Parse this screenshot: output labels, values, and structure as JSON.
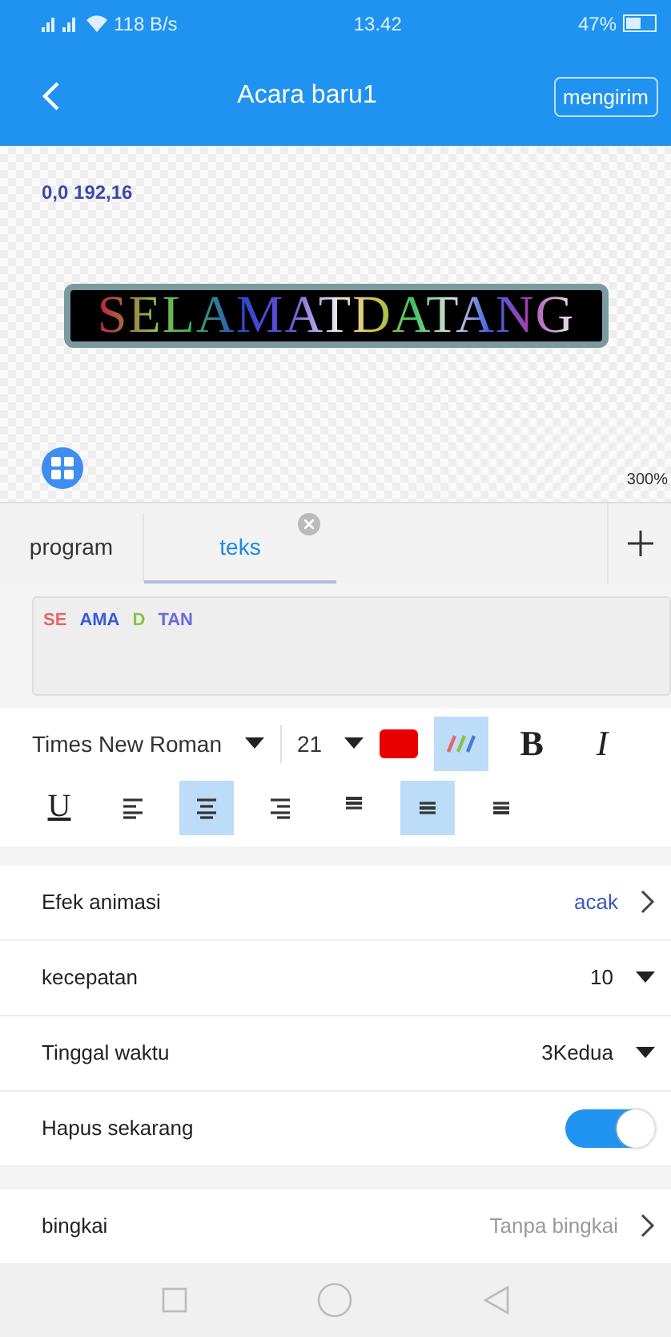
{
  "status_bar": {
    "speed": "118 B/s",
    "time": "13.42",
    "battery": "47%"
  },
  "header": {
    "title": "Acara baru1",
    "send_button": "mengirim"
  },
  "canvas": {
    "coords": "0,0 192,16",
    "zoom": "300%",
    "led_text": "SELAMATDATANG"
  },
  "tabs": [
    {
      "label": "program",
      "selected": false,
      "closable": false
    },
    {
      "label": "teks",
      "selected": true,
      "closable": true
    }
  ],
  "text_field": {
    "segments": [
      {
        "text": "SE",
        "color": "#e06a6a"
      },
      {
        "text": "AMA",
        "color": "#3a5ad8"
      },
      {
        "text": "D",
        "color": "#8cc04a"
      },
      {
        "text": "TAN",
        "color": "#6a6ae0"
      }
    ]
  },
  "font": {
    "family": "Times New Roman",
    "size": "21",
    "color": "#e80000"
  },
  "format_buttons": [
    {
      "kind": "gradient",
      "selected": true
    },
    {
      "kind": "bold",
      "label": "B",
      "selected": false
    },
    {
      "kind": "italic",
      "label": "I",
      "selected": false
    }
  ],
  "align_buttons": [
    {
      "kind": "underline",
      "label": "U",
      "selected": false
    },
    {
      "kind": "left",
      "selected": false
    },
    {
      "kind": "center",
      "selected": true
    },
    {
      "kind": "right",
      "selected": false
    },
    {
      "kind": "top",
      "selected": false
    },
    {
      "kind": "middle",
      "selected": true
    },
    {
      "kind": "bottom",
      "selected": false
    }
  ],
  "settings": [
    {
      "kind": "link",
      "label": "Efek animasi",
      "value": "acak"
    },
    {
      "kind": "dropdown",
      "label": "kecepatan",
      "value": "10"
    },
    {
      "kind": "dropdown",
      "label": "Tinggal waktu",
      "value": "3Kedua"
    },
    {
      "kind": "switch",
      "label": "Hapus sekarang",
      "on": true
    }
  ],
  "frame_setting": {
    "label": "bingkai",
    "value": "Tanpa bingkai"
  }
}
